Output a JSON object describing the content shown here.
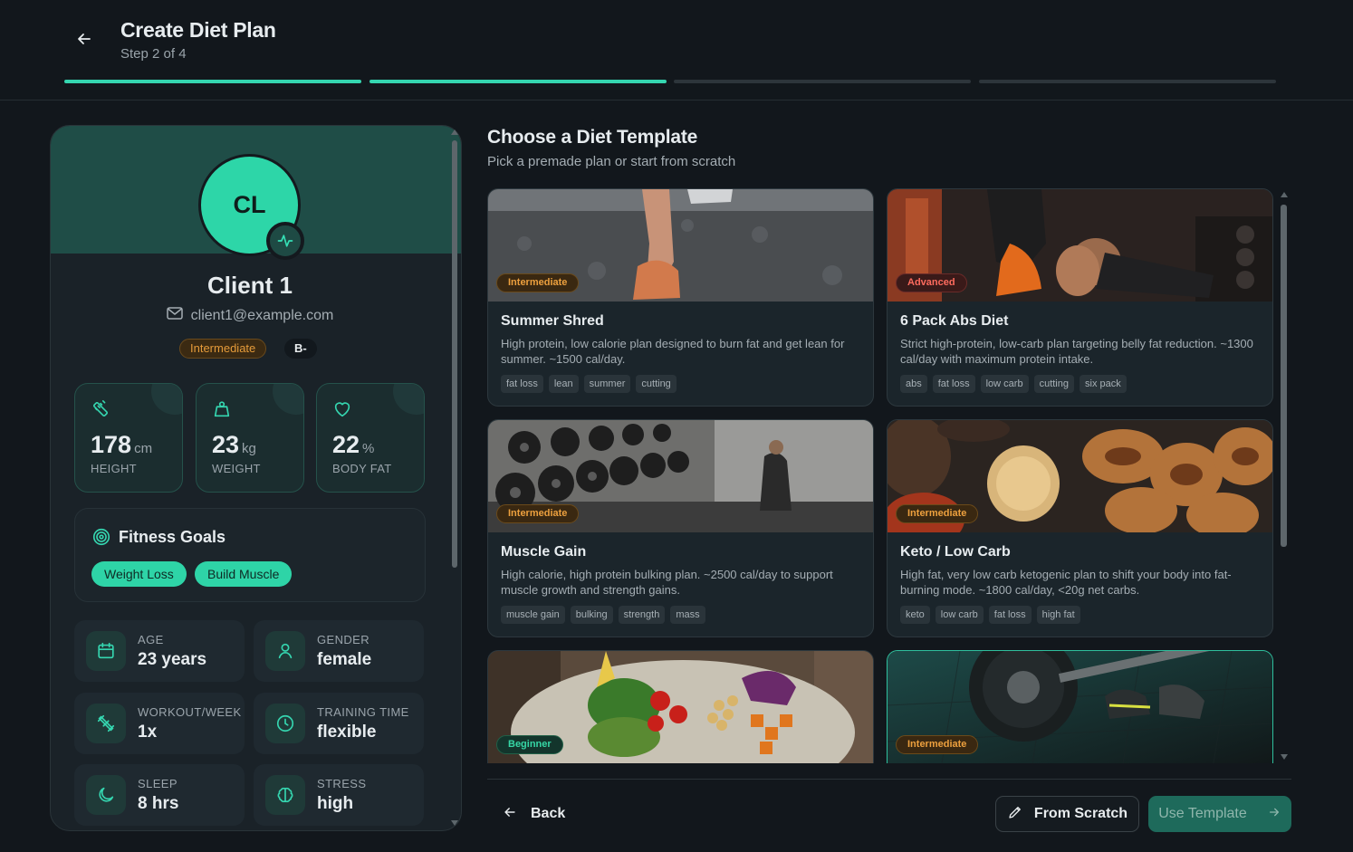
{
  "header": {
    "title": "Create Diet Plan",
    "step": "Step 2 of 4",
    "progress_total": 4,
    "progress_done": 2
  },
  "client": {
    "initials": "CL",
    "name": "Client 1",
    "email": "client1@example.com",
    "level": "Intermediate",
    "grade": "B-",
    "stats": [
      {
        "value": "178",
        "unit": "cm",
        "label": "HEIGHT",
        "icon": "ruler-icon"
      },
      {
        "value": "23",
        "unit": "kg",
        "label": "WEIGHT",
        "icon": "weight-icon"
      },
      {
        "value": "22",
        "unit": "%",
        "label": "BODY FAT",
        "icon": "heart-icon"
      }
    ],
    "goals_title": "Fitness Goals",
    "goals": [
      "Weight Loss",
      "Build Muscle"
    ],
    "info": [
      {
        "label": "AGE",
        "value": "23 years",
        "icon": "calendar-icon"
      },
      {
        "label": "GENDER",
        "value": "female",
        "icon": "user-icon"
      },
      {
        "label": "WORKOUT/WEEK",
        "value": "1x",
        "icon": "dumbbell-icon"
      },
      {
        "label": "TRAINING TIME",
        "value": "flexible",
        "icon": "clock-icon"
      },
      {
        "label": "SLEEP",
        "value": "8 hrs",
        "icon": "moon-icon"
      },
      {
        "label": "STRESS",
        "value": "high",
        "icon": "brain-icon"
      }
    ]
  },
  "templates_section": {
    "title": "Choose a Diet Template",
    "subtitle": "Pick a premade plan or start from scratch"
  },
  "templates": [
    {
      "name": "Summer Shred",
      "level": "Intermediate",
      "desc": "High protein, low calorie plan designed to burn fat and get lean for summer. ~1500 cal/day.",
      "tags": [
        "fat loss",
        "lean",
        "summer",
        "cutting"
      ]
    },
    {
      "name": "6 Pack Abs Diet",
      "level": "Advanced",
      "desc": "Strict high-protein, low-carb plan targeting belly fat reduction. ~1300 cal/day with maximum protein intake.",
      "tags": [
        "abs",
        "fat loss",
        "low carb",
        "cutting",
        "six pack"
      ]
    },
    {
      "name": "Muscle Gain",
      "level": "Intermediate",
      "desc": "High calorie, high protein bulking plan. ~2500 cal/day to support muscle growth and strength gains.",
      "tags": [
        "muscle gain",
        "bulking",
        "strength",
        "mass"
      ]
    },
    {
      "name": "Keto / Low Carb",
      "level": "Intermediate",
      "desc": "High fat, very low carb ketogenic plan to shift your body into fat-burning mode. ~1800 cal/day, <20g net carbs.",
      "tags": [
        "keto",
        "low carb",
        "fat loss",
        "high fat"
      ]
    },
    {
      "name": "",
      "level": "Beginner",
      "desc": "",
      "tags": []
    },
    {
      "name": "",
      "level": "Intermediate",
      "desc": "",
      "tags": []
    }
  ],
  "footer": {
    "back": "Back",
    "from_scratch": "From Scratch",
    "use_template": "Use Template"
  },
  "colors": {
    "accent": "#35d6b0",
    "intermediate": "#eda03e",
    "advanced": "#ff6b5e",
    "beginner": "#36d6a5"
  }
}
